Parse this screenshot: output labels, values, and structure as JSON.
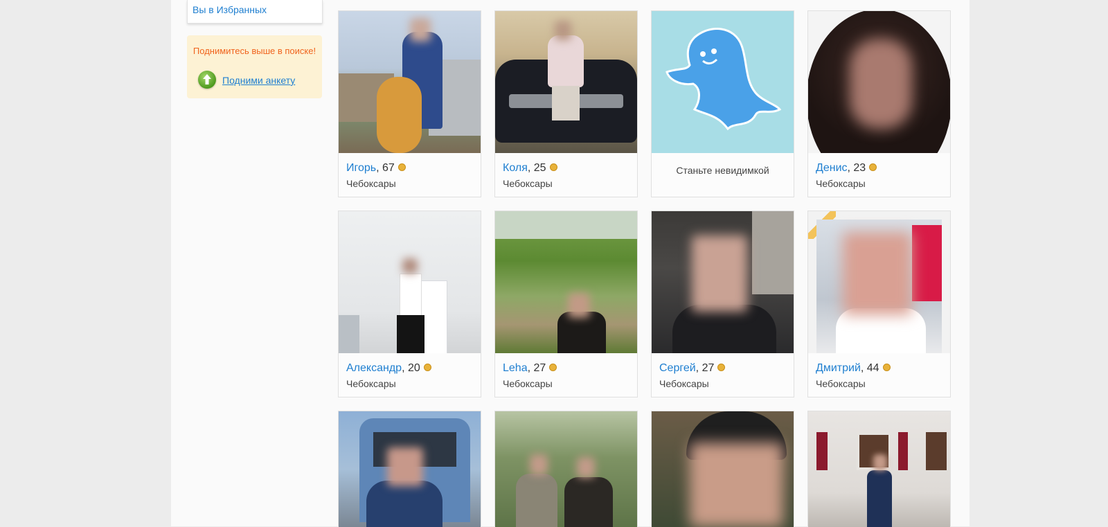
{
  "sidebar": {
    "favorites_link": "Вы в Избранных",
    "promo": {
      "text": "Поднимитесь выше в поиске!",
      "link": "Подними анкету",
      "icon": "arrow-up-icon"
    }
  },
  "profiles": [
    {
      "name": "Игорь",
      "age": ", 67",
      "city": "Чебоксары"
    },
    {
      "name": "Коля",
      "age": ", 25",
      "city": "Чебоксары"
    },
    {
      "invisible_text": "Станьте невидимкой"
    },
    {
      "name": "Денис",
      "age": ", 23",
      "city": "Чебоксары"
    },
    {
      "name": "Александр",
      "age": ", 20",
      "city": "Чебоксары"
    },
    {
      "name": "Leha",
      "age": ", 27",
      "city": "Чебоксары"
    },
    {
      "name": "Сергей",
      "age": ", 27",
      "city": "Чебоксары"
    },
    {
      "name": "Дмитрий",
      "age": ", 44",
      "city": "Чебоксары"
    }
  ],
  "colors": {
    "accent": "#1f7fd0",
    "promo_text": "#f0641e",
    "online_dot": "#e8b23a"
  }
}
